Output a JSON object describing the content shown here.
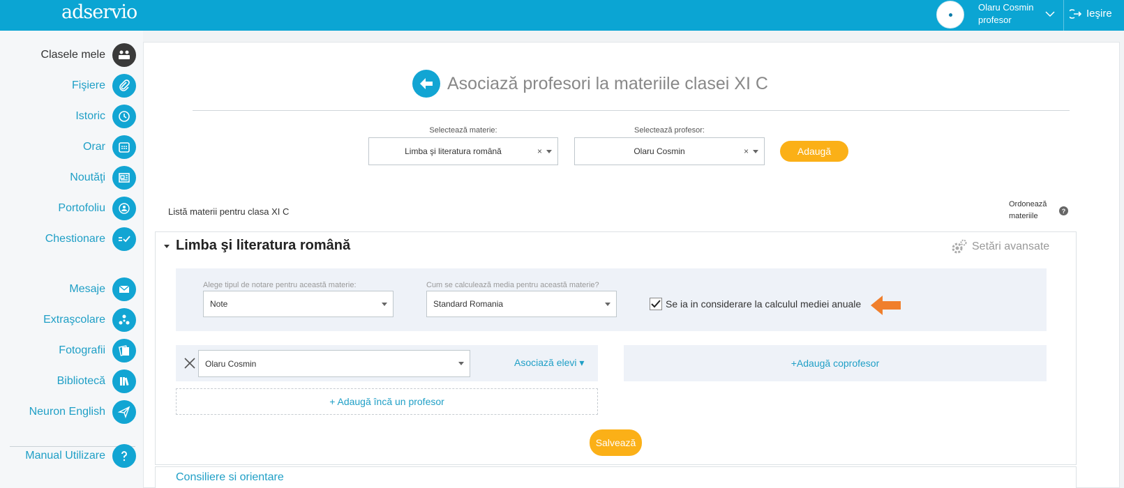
{
  "brand": {
    "logo_text": "adservio",
    "accent": "#0ba5d3",
    "orange": "#fbb017"
  },
  "user": {
    "name": "Olaru Cosmin",
    "role": "profesor",
    "logout_label": "Ieşire"
  },
  "sidebar": {
    "items": [
      {
        "label": "Clasele mele",
        "icon": "classes-icon",
        "active": true
      },
      {
        "label": "Fişiere",
        "icon": "paperclip-icon"
      },
      {
        "label": "Istoric",
        "icon": "history-icon"
      },
      {
        "label": "Orar",
        "icon": "calendar-icon"
      },
      {
        "label": "Noutăţi",
        "icon": "news-icon"
      },
      {
        "label": "Portofoliu",
        "icon": "portfolio-icon"
      },
      {
        "label": "Chestionare",
        "icon": "checklist-icon"
      },
      {
        "label": "Mesaje",
        "icon": "envelope-icon"
      },
      {
        "label": "Extraşcolare",
        "icon": "spinner-icon"
      },
      {
        "label": "Fotografii",
        "icon": "photos-icon"
      },
      {
        "label": "Bibliotecă",
        "icon": "books-icon"
      },
      {
        "label": "Neuron English",
        "icon": "paper-plane-icon"
      }
    ],
    "manual_label": "Manual Utilizare"
  },
  "page": {
    "title": "Asociază profesori la materiile clasei XI C",
    "subject_select": {
      "label": "Selectează materie:",
      "value": "Limba şi literatura română"
    },
    "teacher_select": {
      "label": "Selectează profesor:",
      "value": "Olaru Cosmin"
    },
    "add_button": "Adaugă",
    "list_title": "Listă materii pentru clasa XI C",
    "order_label_line1": "Ordonează",
    "order_label_line2": "materiile",
    "help_glyph": "?"
  },
  "subject_card": {
    "title": "Limba şi literatura română",
    "advanced_settings": "Setări avansate",
    "grading_label": "Alege tipul de notare pentru această materie:",
    "grading_value": "Note",
    "average_label": "Cum se calculează media pentru această materie?",
    "average_value": "Standard Romania",
    "annual_checkbox_label": "Se ia in considerare la calculul mediei anuale",
    "annual_checked": true,
    "teacher_value": "Olaru Cosmin",
    "associate_students": "Asociază elevi ▾",
    "add_another_teacher": "+ Adaugă încă un profesor",
    "add_coteacher": "+Adaugă coprofesor",
    "save_button": "Salvează"
  },
  "next_card": {
    "title": "Consiliere si orientare"
  }
}
